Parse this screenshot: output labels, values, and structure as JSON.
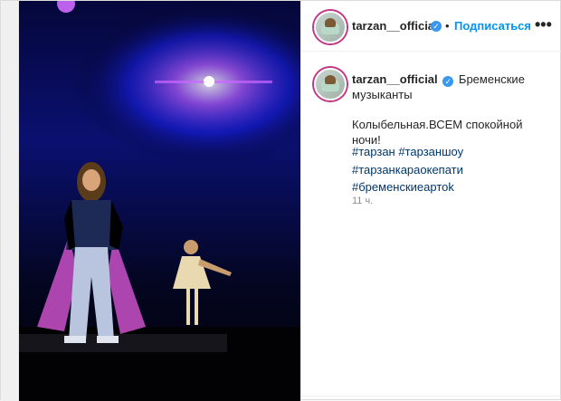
{
  "header": {
    "username": "tarzan__official",
    "separator": "•",
    "follow_label": "Подписаться",
    "more_label": "•••"
  },
  "caption": {
    "username": "tarzan__official",
    "text_line_1": "Бременские",
    "text_line_2": "музыканты",
    "body_1": "Колыбельная.ВСЕМ спокойной",
    "body_2": "ночи!"
  },
  "hashtags": [
    "#тарзан",
    "#тарзаншоу",
    "#тарзанкараокепати",
    "#бременскиеартоk"
  ],
  "timestamp": "11 ч.",
  "colors": {
    "accent": "#0095f6",
    "hashtag": "#00376b",
    "muted": "#8e8e8e"
  },
  "icons": {
    "verified": "verified-badge-icon"
  }
}
